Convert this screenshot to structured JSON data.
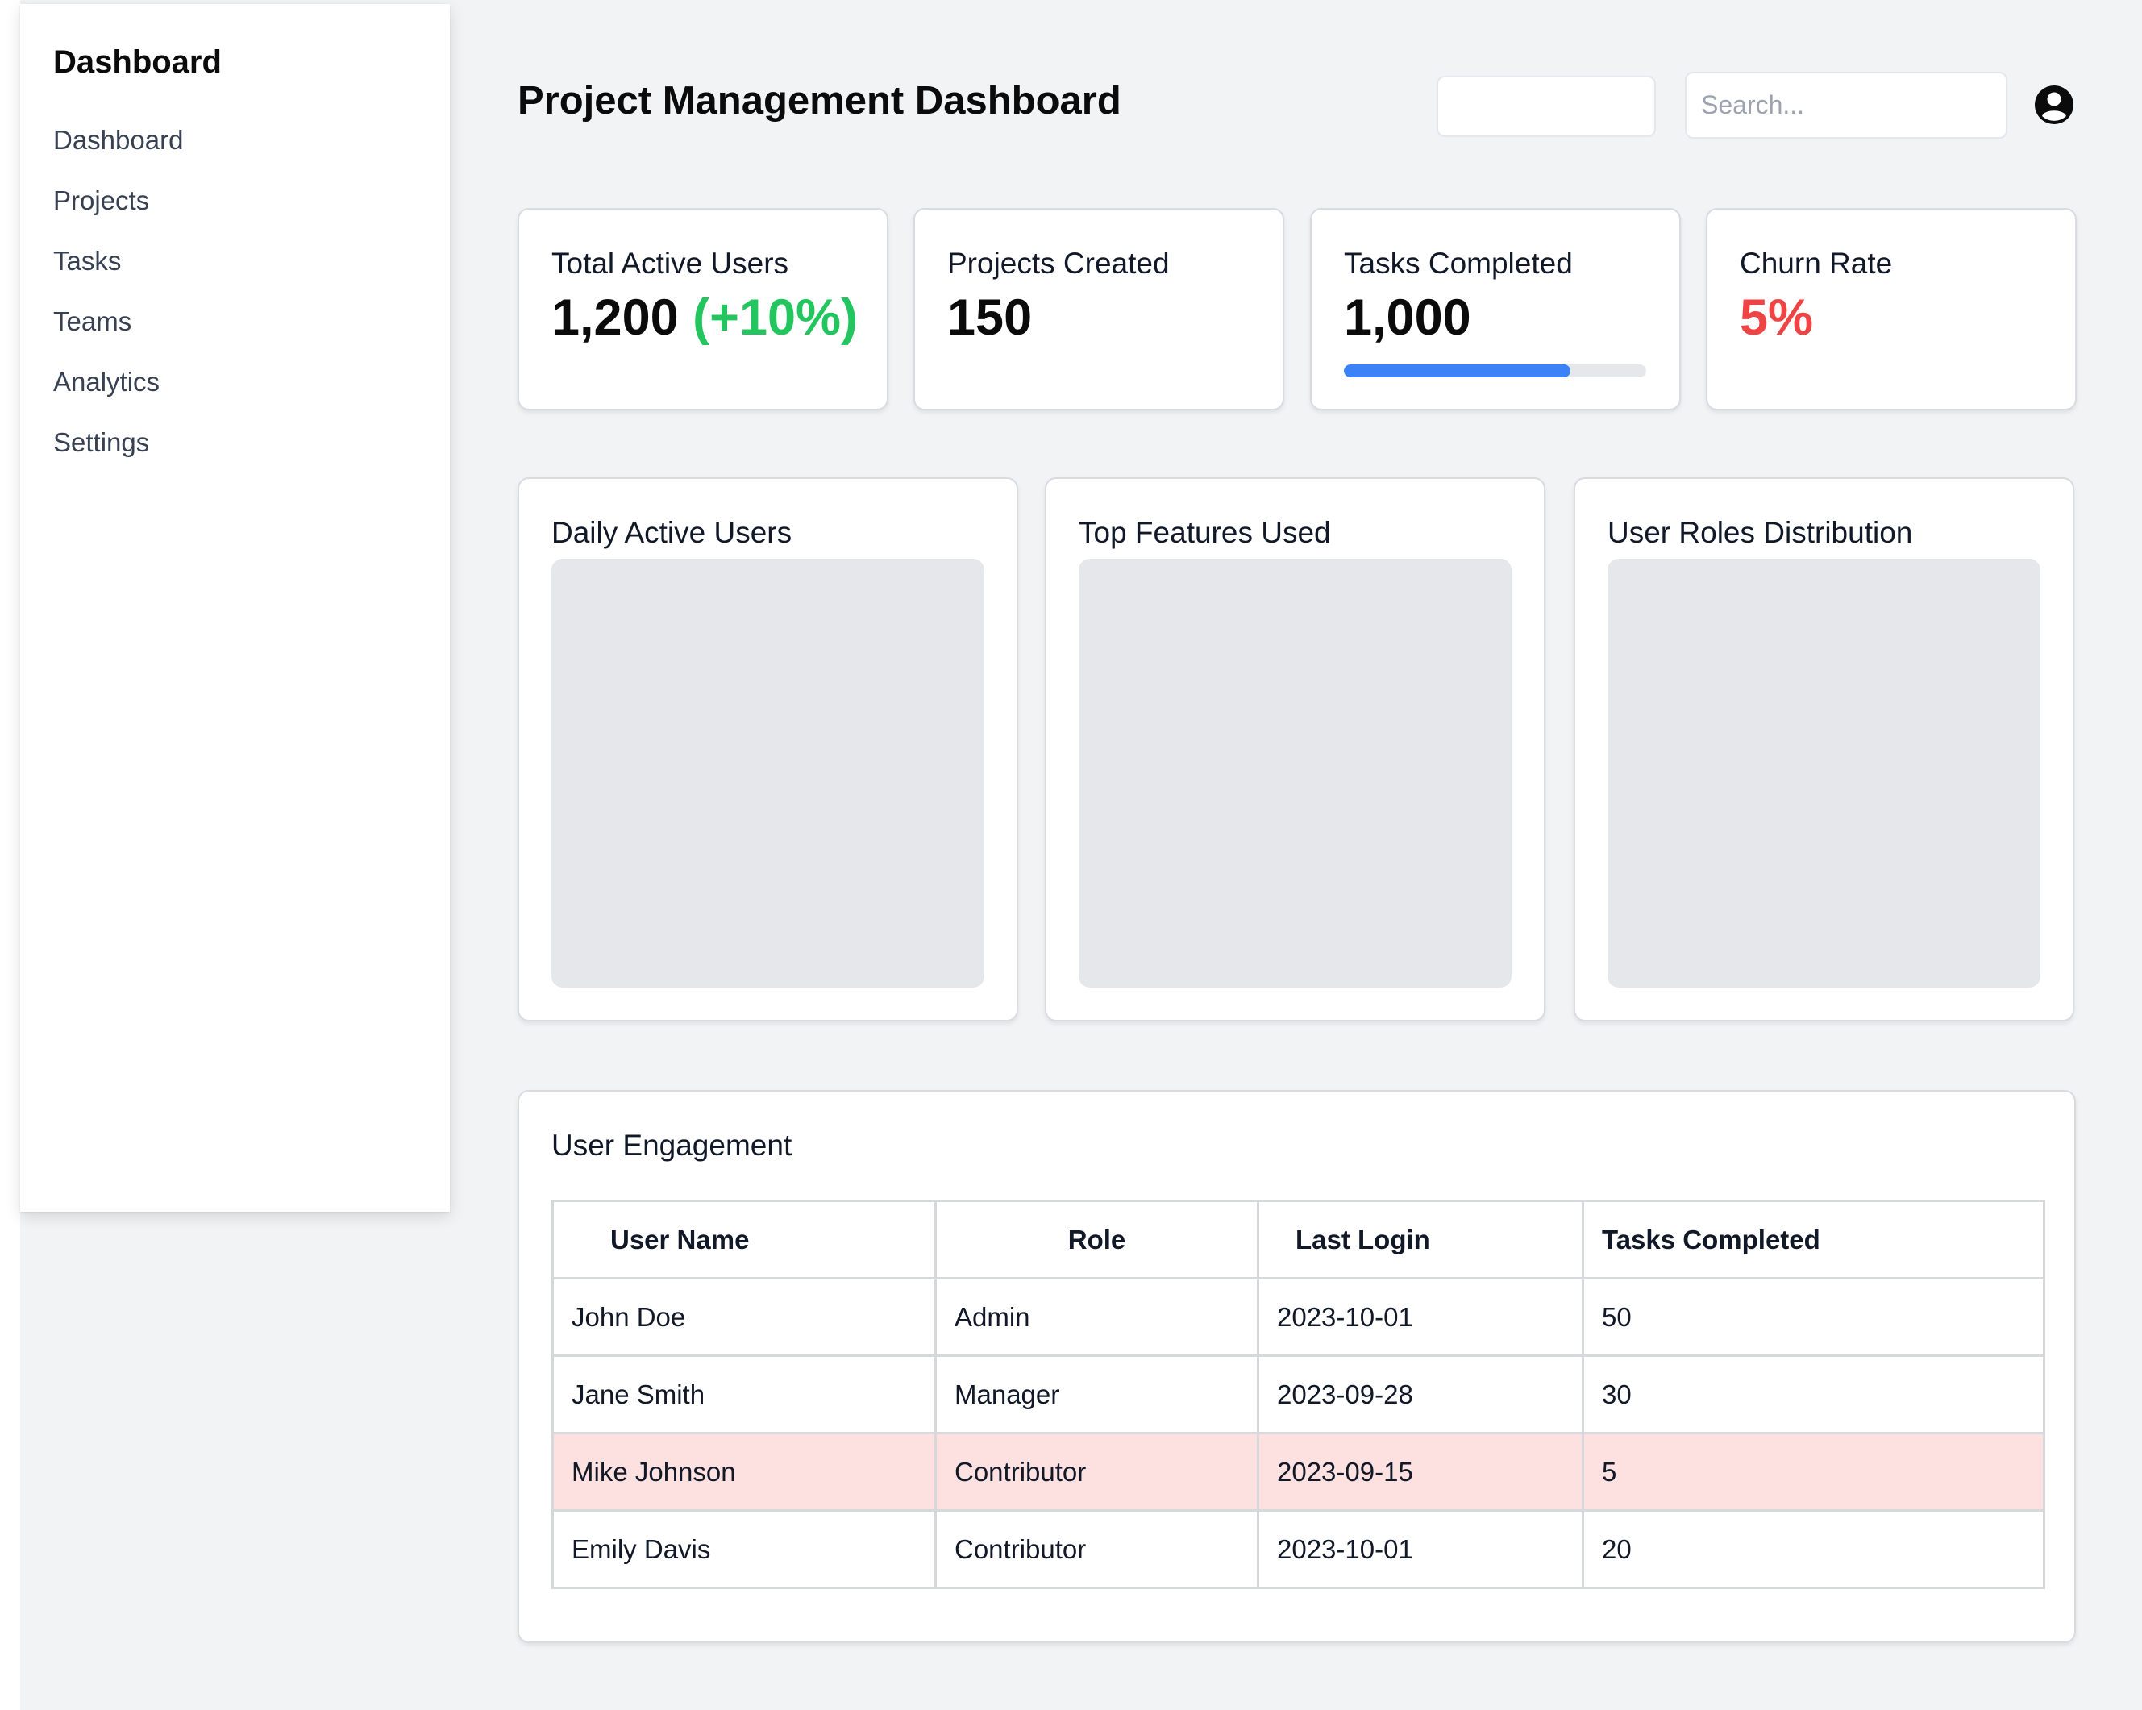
{
  "sidebar": {
    "title": "Dashboard",
    "items": [
      {
        "label": "Dashboard"
      },
      {
        "label": "Projects"
      },
      {
        "label": "Tasks"
      },
      {
        "label": "Teams"
      },
      {
        "label": "Analytics"
      },
      {
        "label": "Settings"
      }
    ]
  },
  "header": {
    "title": "Project Management Dashboard",
    "search_placeholder": "Search..."
  },
  "stats": [
    {
      "label": "Total Active Users",
      "value": "1,200",
      "delta": "(+10%)"
    },
    {
      "label": "Projects Created",
      "value": "150"
    },
    {
      "label": "Tasks Completed",
      "value": "1,000",
      "progress": 0.75
    },
    {
      "label": "Churn Rate",
      "value": "5%"
    }
  ],
  "charts": [
    {
      "title": "Daily Active Users"
    },
    {
      "title": "Top Features Used"
    },
    {
      "title": "User Roles Distribution"
    }
  ],
  "engagement": {
    "title": "User Engagement",
    "columns": [
      "User Name",
      "Role",
      "Last Login",
      "Tasks Completed"
    ],
    "rows": [
      [
        "John Doe",
        "Admin",
        "2023-10-01",
        "50"
      ],
      [
        "Jane Smith",
        "Manager",
        "2023-09-28",
        "30"
      ],
      [
        "Mike Johnson",
        "Contributor",
        "2023-09-15",
        "5"
      ],
      [
        "Emily Davis",
        "Contributor",
        "2023-10-01",
        "20"
      ]
    ],
    "highlighted_row": 2
  },
  "colors": {
    "positive": "#22c55e",
    "negative": "#ef4444",
    "progress": "#3b82f6",
    "highlight_row": "#fde1e1"
  },
  "icons": {
    "user": "user-circle-icon"
  }
}
